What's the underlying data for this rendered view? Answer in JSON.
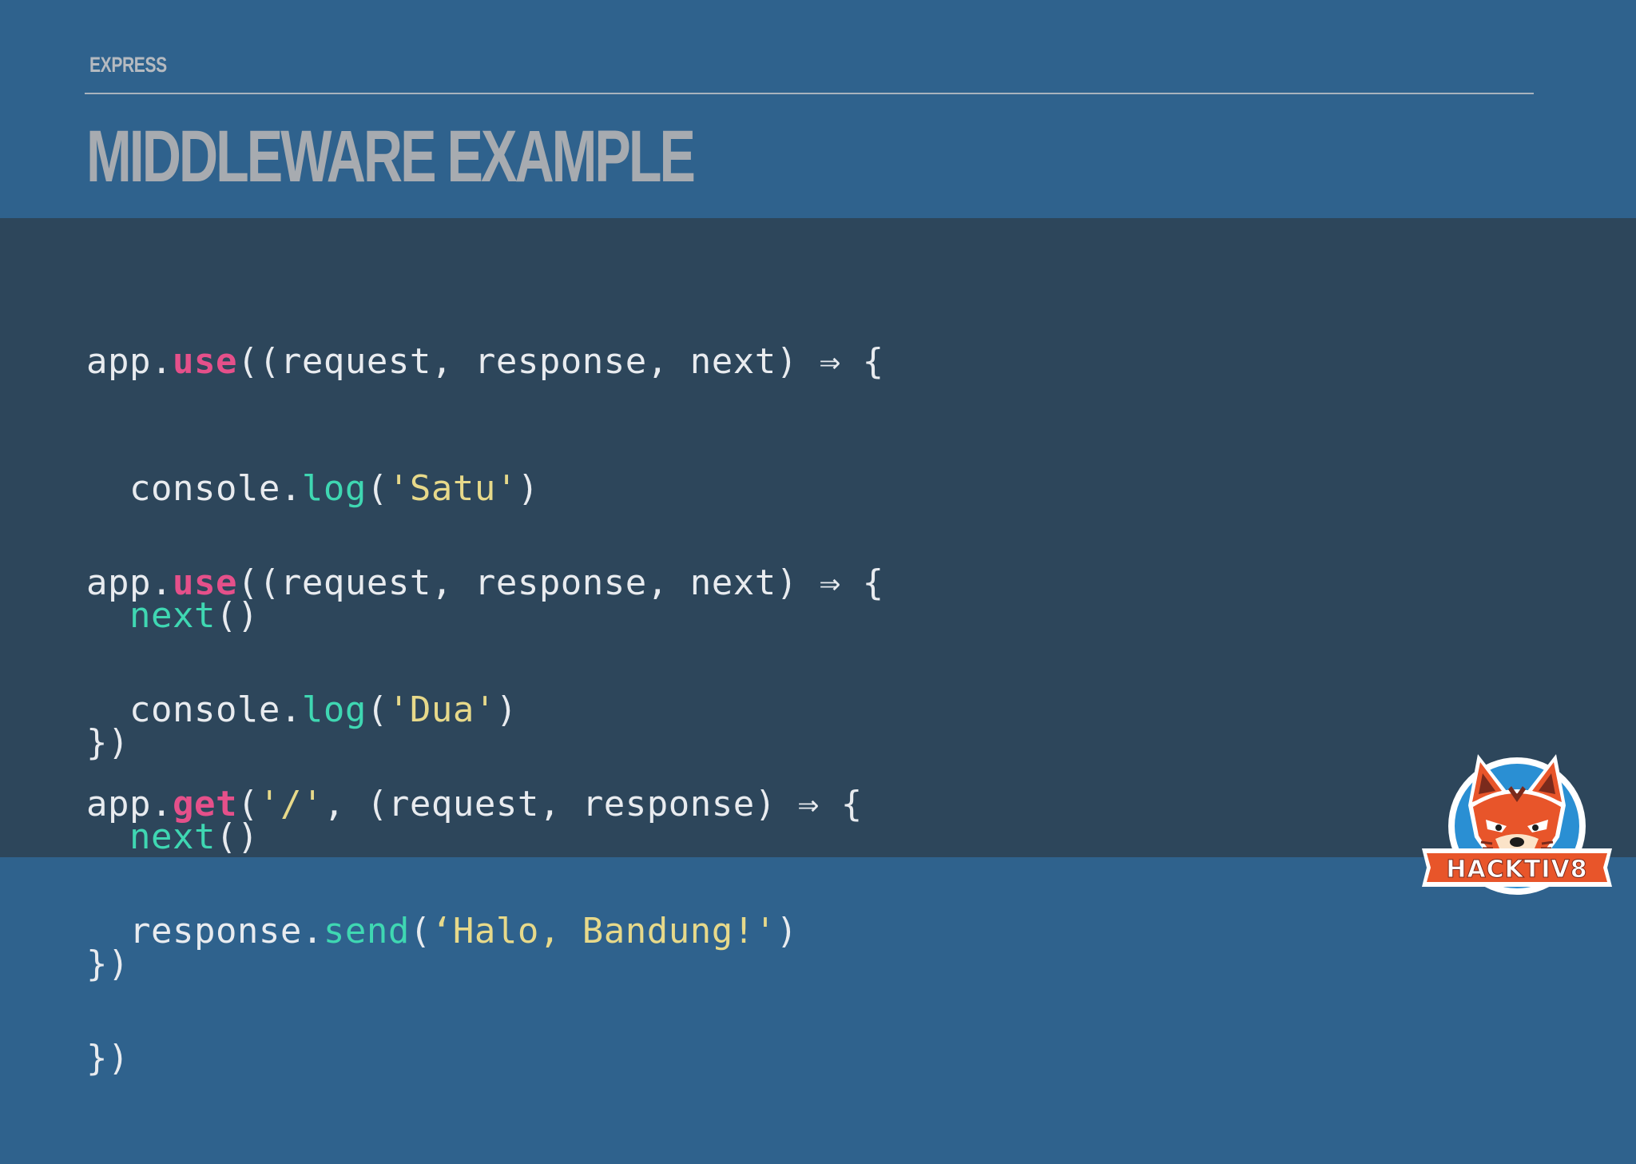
{
  "slide": {
    "section_label": "EXPRESS",
    "title": "MIDDLEWARE EXAMPLE"
  },
  "code": {
    "block1": {
      "line1": {
        "a": "app.",
        "b": "use",
        "c": "((request, response, next) ⇒ {"
      },
      "line2": {
        "a": "  console.",
        "b": "log",
        "c": "(",
        "d": "'Satu'",
        "e": ")"
      },
      "line3": {
        "a": "  ",
        "b": "next",
        "c": "()"
      },
      "line4": "})"
    },
    "block2": {
      "line1": {
        "a": "app.",
        "b": "use",
        "c": "((request, response, next) ⇒ {"
      },
      "line2": {
        "a": "  console.",
        "b": "log",
        "c": "(",
        "d": "'Dua'",
        "e": ")"
      },
      "line3": {
        "a": "  ",
        "b": "next",
        "c": "()"
      },
      "line4": "})"
    },
    "block3": {
      "line1": {
        "a": "app.",
        "b": "get",
        "c": "(",
        "d": "'/'",
        "e": ", (request, response) ⇒ {"
      },
      "line2": {
        "a": "  response.",
        "b": "send",
        "c": "(",
        "d": "‘Halo, Bandung!'",
        "e": ")"
      },
      "line3": "})"
    }
  },
  "logo": {
    "text": "HACKTIV8",
    "icon": "fox-mascot-icon"
  },
  "colors": {
    "background": "#2f628d",
    "code_panel": "#2d465b",
    "keyword": "#e5508a",
    "function": "#3fd7b2",
    "string": "#e7d98a",
    "title": "#a7abb0"
  }
}
